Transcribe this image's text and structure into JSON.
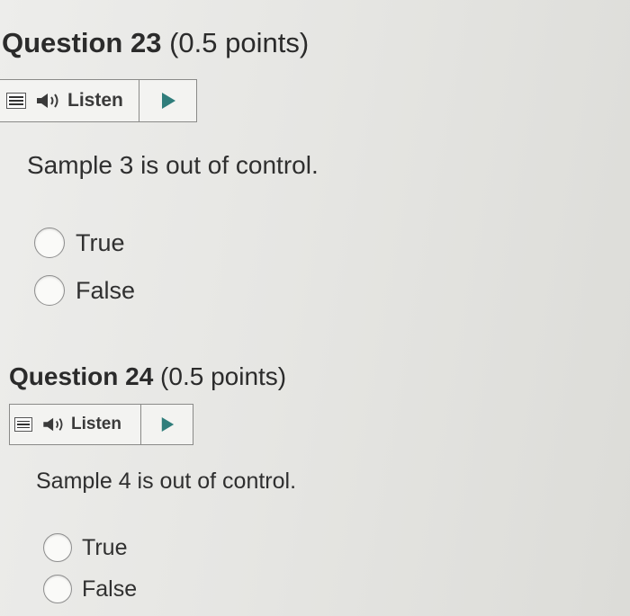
{
  "questions": [
    {
      "number_label": "Question 23",
      "points_label": "(0.5 points)",
      "listen_label": "Listen",
      "prompt": "Sample 3 is out of control.",
      "options": [
        "True",
        "False"
      ]
    },
    {
      "number_label": "Question 24",
      "points_label": "(0.5 points)",
      "listen_label": "Listen",
      "prompt": "Sample 4 is out of control.",
      "options": [
        "True",
        "False"
      ]
    }
  ],
  "icons": {
    "menu": "menu-icon",
    "speaker": "speaker-icon",
    "play": "play-icon"
  },
  "colors": {
    "background": "#e6e6e3",
    "text": "#2b2b2b",
    "border": "#8a8a88",
    "accent": "#2f7d7b"
  }
}
